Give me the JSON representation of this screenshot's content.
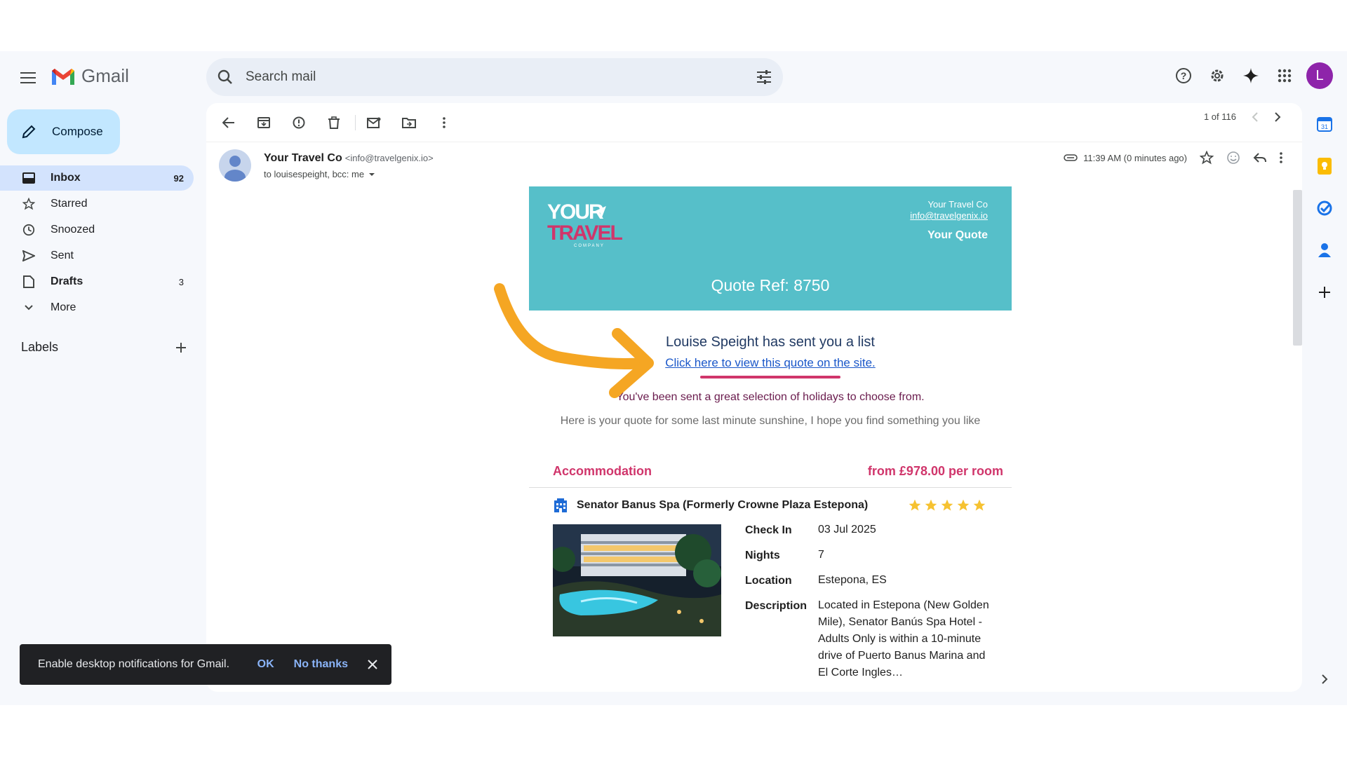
{
  "app": {
    "title": "Gmail"
  },
  "search": {
    "placeholder": "Search mail"
  },
  "account": {
    "initial": "L"
  },
  "compose": {
    "label": "Compose"
  },
  "nav": [
    {
      "label": "Inbox",
      "count": "92",
      "icon": "inbox-icon",
      "active": true
    },
    {
      "label": "Starred",
      "count": "",
      "icon": "star-icon"
    },
    {
      "label": "Snoozed",
      "count": "",
      "icon": "clock-icon"
    },
    {
      "label": "Sent",
      "count": "",
      "icon": "send-icon"
    },
    {
      "label": "Drafts",
      "count": "3",
      "icon": "file-icon"
    },
    {
      "label": "More",
      "count": "",
      "icon": "chevron-down-icon"
    }
  ],
  "labels": {
    "title": "Labels"
  },
  "pager": {
    "text": "1 of 116"
  },
  "message": {
    "sender_name": "Your Travel Co",
    "sender_email": "<info@travelgenix.io>",
    "recipients": "to louisespeight, bcc: me",
    "time": "11:39 AM (0 minutes ago)"
  },
  "email": {
    "brand_line1": "YOUR",
    "brand_line2": "TRAVEL",
    "brand_sub": "COMPANY",
    "company": "Your Travel Co",
    "company_email": "info@travelgenix.io",
    "quote_label": "Your Quote",
    "quote_ref": "Quote Ref: 8750",
    "intro_title": "Louise Speight has sent you a list",
    "intro_link": "Click here to view this quote on the site.",
    "intro_sent": "You've been sent a great selection of holidays to choose from.",
    "intro_here": "Here is your quote for some last minute sunshine, I hope you find something you like",
    "acc_title": "Accommodation",
    "acc_price": "from £978.00 per room",
    "hotel_name": "Senator Banus Spa (Formerly Crowne Plaza Estepona)",
    "rating_stars": 5,
    "facts": [
      {
        "label": "Check In",
        "value": "03 Jul 2025"
      },
      {
        "label": "Nights",
        "value": "7"
      },
      {
        "label": "Location",
        "value": "Estepona, ES"
      },
      {
        "label": "Description",
        "value": "Located in Estepona (New Golden Mile), Senator Banús Spa Hotel - Adults Only is within a 10-minute drive of Puerto Banus Marina and El Corte Ingles…"
      }
    ]
  },
  "toast": {
    "message": "Enable desktop notifications for Gmail.",
    "ok": "OK",
    "no": "No thanks"
  },
  "colors": {
    "hero": "#56bfc9",
    "accent_pink": "#d0356b",
    "arrow": "#f5a623",
    "compose": "#c2e7ff",
    "nav_active": "#d3e3fd"
  }
}
